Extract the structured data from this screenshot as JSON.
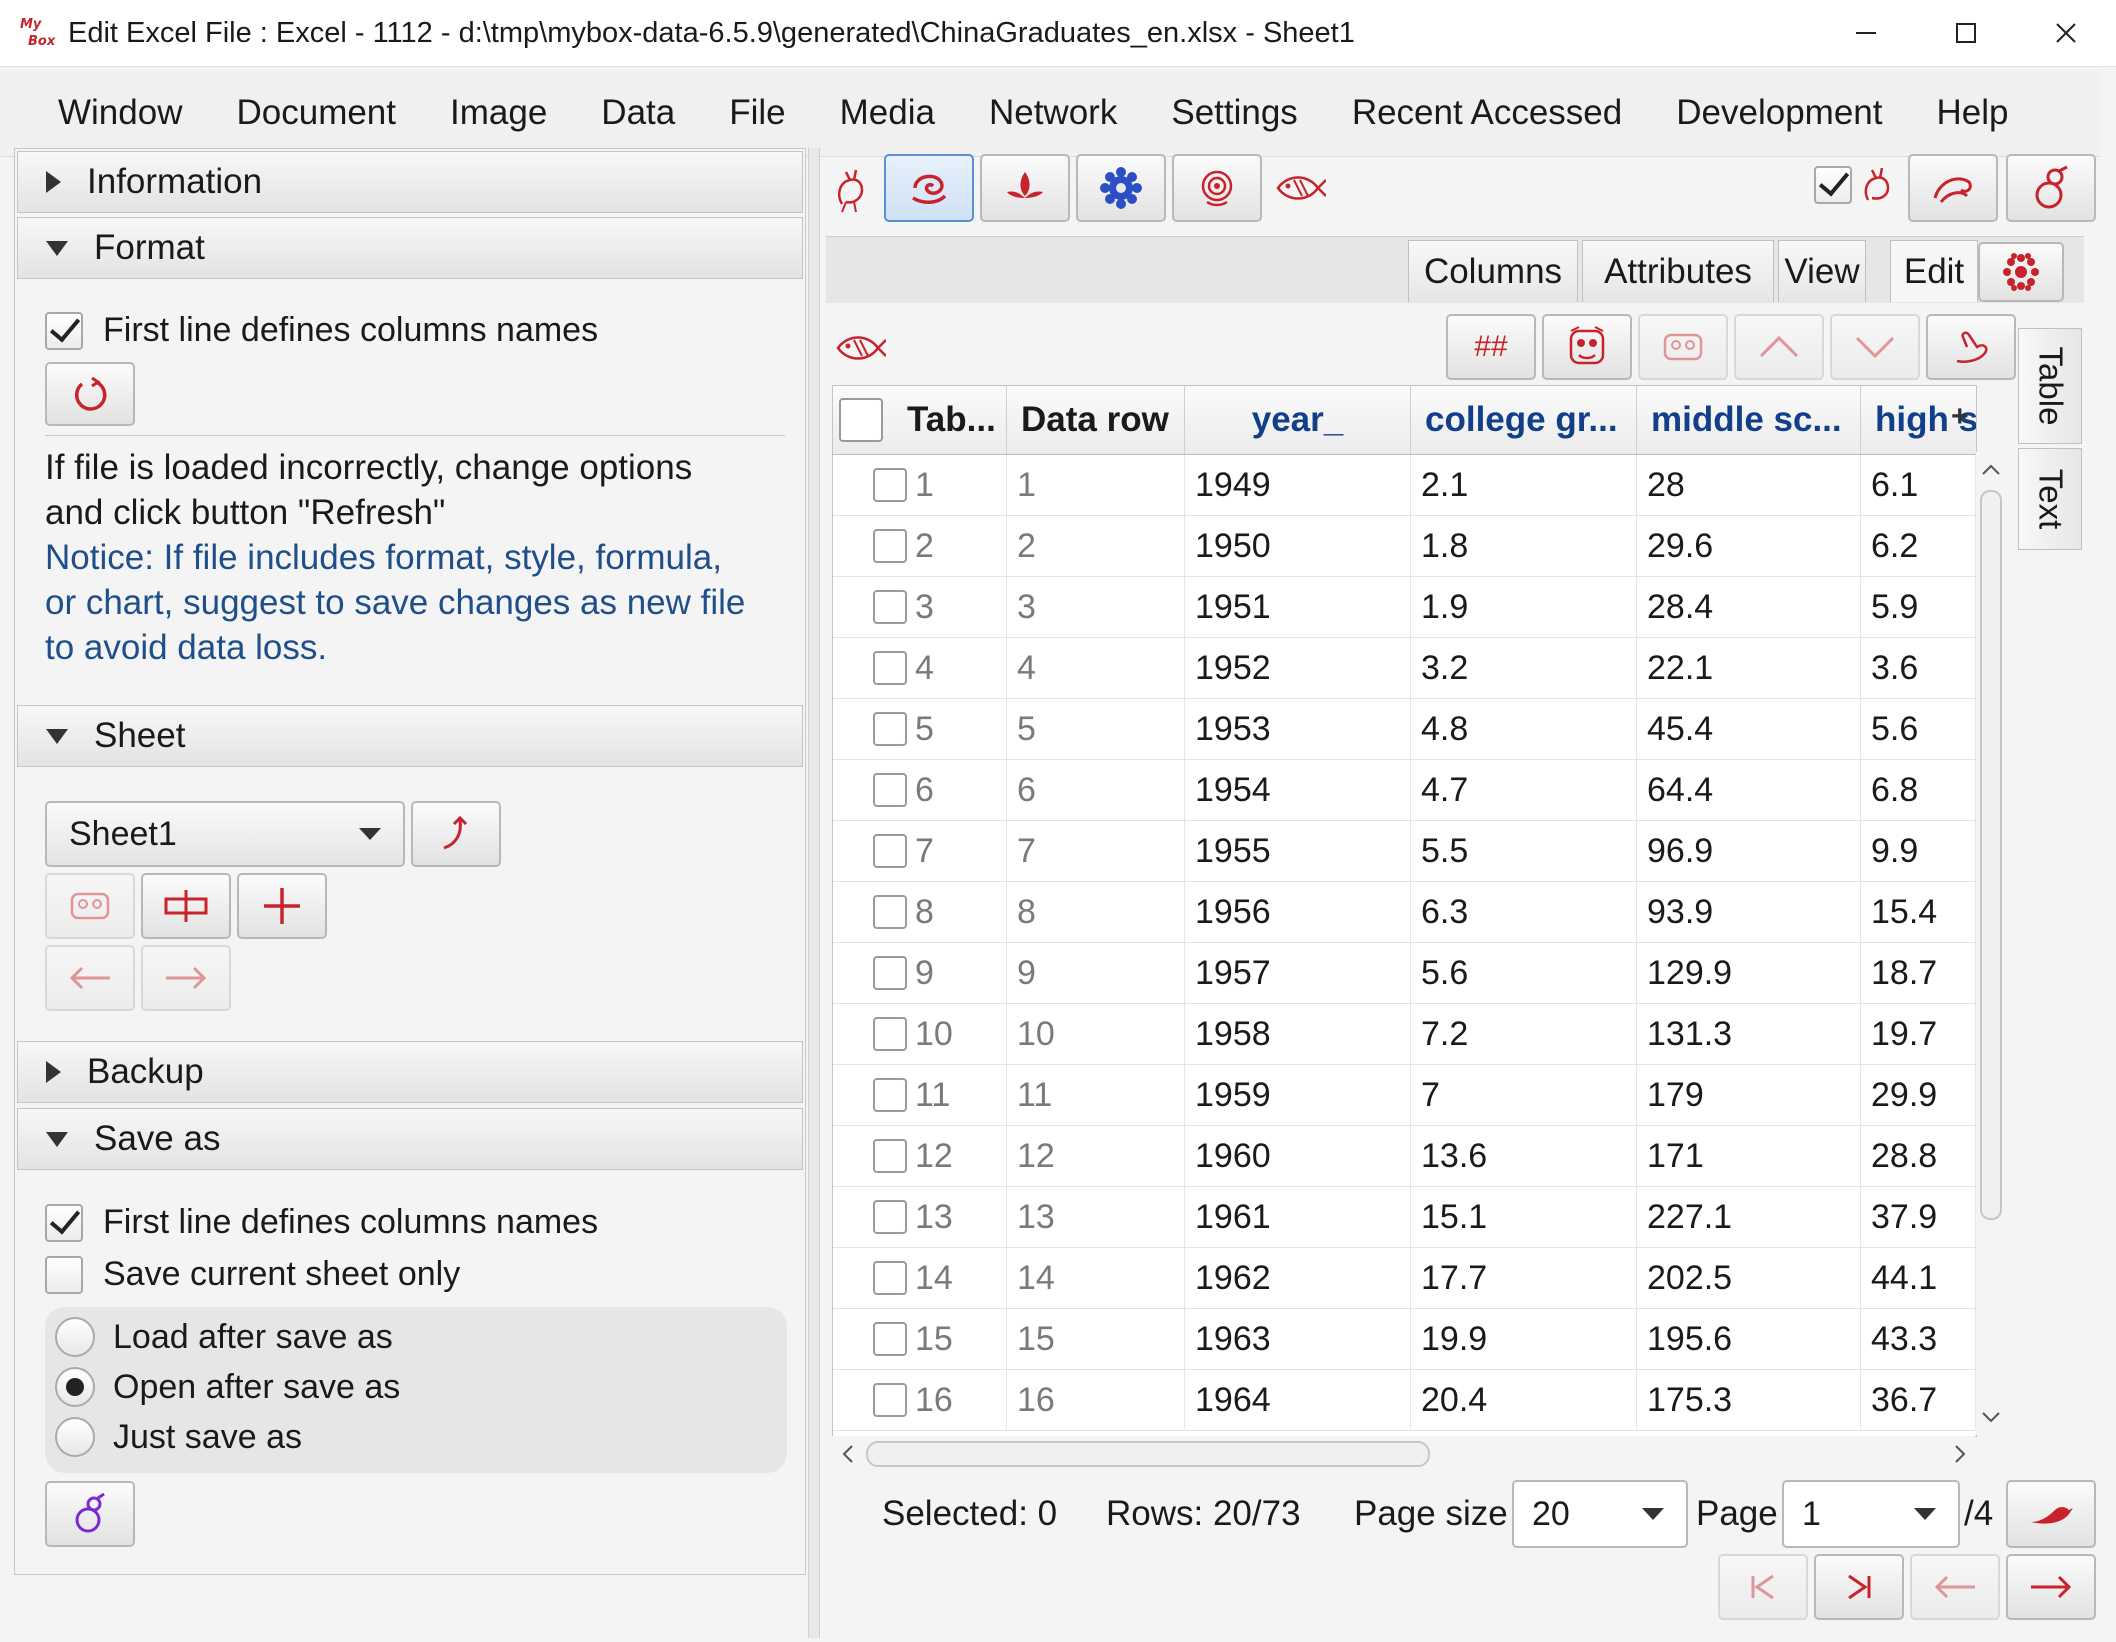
{
  "window": {
    "title": "Edit Excel File : Excel - 1112 - d:\\tmp\\mybox-data-6.5.9\\generated\\ChinaGraduates_en.xlsx - Sheet1",
    "logo_text": "MyBox"
  },
  "menu": [
    "Window",
    "Document",
    "Image",
    "Data",
    "File",
    "Media",
    "Network",
    "Settings",
    "Recent Accessed",
    "Development",
    "Help"
  ],
  "left": {
    "information_label": "Information",
    "format_label": "Format",
    "format_first_line_label": "First line defines columns names",
    "format_first_line_checked": true,
    "hint_text_line1": "If file is loaded incorrectly, change options",
    "hint_text_line2": "and click button \"Refresh\"",
    "notice_line1": "Notice: If file includes format, style, formula,",
    "notice_line2": "or chart, suggest to save changes as new file",
    "notice_line3": "to avoid data loss.",
    "sheet_label": "Sheet",
    "sheet_selected": "Sheet1",
    "backup_label": "Backup",
    "saveas_label": "Save as",
    "saveas_first_line_label": "First line defines columns names",
    "saveas_first_line_checked": true,
    "save_current_only_label": "Save current sheet only",
    "save_current_only_checked": false,
    "radio_load_label": "Load after save as",
    "radio_open_label": "Open after save as",
    "radio_just_label": "Just save as",
    "radio_selected": "Open after save as"
  },
  "right": {
    "tabs": [
      "Columns",
      "Attributes",
      "View",
      "Edit"
    ],
    "selected_tab": "Edit",
    "vertical_tabs": [
      "Table",
      "Text"
    ],
    "hash_button": "##",
    "table": {
      "headers": [
        "Tab...",
        "Data row",
        "year_",
        "college gr...",
        "middle sc...",
        "high s"
      ],
      "rows": [
        [
          "1",
          "1",
          "1949",
          "2.1",
          "28",
          "6.1"
        ],
        [
          "2",
          "2",
          "1950",
          "1.8",
          "29.6",
          "6.2"
        ],
        [
          "3",
          "3",
          "1951",
          "1.9",
          "28.4",
          "5.9"
        ],
        [
          "4",
          "4",
          "1952",
          "3.2",
          "22.1",
          "3.6"
        ],
        [
          "5",
          "5",
          "1953",
          "4.8",
          "45.4",
          "5.6"
        ],
        [
          "6",
          "6",
          "1954",
          "4.7",
          "64.4",
          "6.8"
        ],
        [
          "7",
          "7",
          "1955",
          "5.5",
          "96.9",
          "9.9"
        ],
        [
          "8",
          "8",
          "1956",
          "6.3",
          "93.9",
          "15.4"
        ],
        [
          "9",
          "9",
          "1957",
          "5.6",
          "129.9",
          "18.7"
        ],
        [
          "10",
          "10",
          "1958",
          "7.2",
          "131.3",
          "19.7"
        ],
        [
          "11",
          "11",
          "1959",
          "7",
          "179",
          "29.9"
        ],
        [
          "12",
          "12",
          "1960",
          "13.6",
          "171",
          "28.8"
        ],
        [
          "13",
          "13",
          "1961",
          "15.1",
          "227.1",
          "37.9"
        ],
        [
          "14",
          "14",
          "1962",
          "17.7",
          "202.5",
          "44.1"
        ],
        [
          "15",
          "15",
          "1963",
          "19.9",
          "195.6",
          "43.3"
        ],
        [
          "16",
          "16",
          "1964",
          "20.4",
          "175.3",
          "36.7"
        ]
      ]
    },
    "status": {
      "selected": "Selected: 0",
      "rows": "Rows: 20/73",
      "page_size_label": "Page size",
      "page_size_value": "20",
      "page_label": "Page",
      "page_value": "1",
      "page_total": "/4"
    },
    "plus_label": "+"
  },
  "colors": {
    "accent_red": "#c8232c",
    "accent_blue": "#1f4f8a",
    "header_blue": "#123f8a",
    "accent_purple": "#7a2bd6"
  }
}
